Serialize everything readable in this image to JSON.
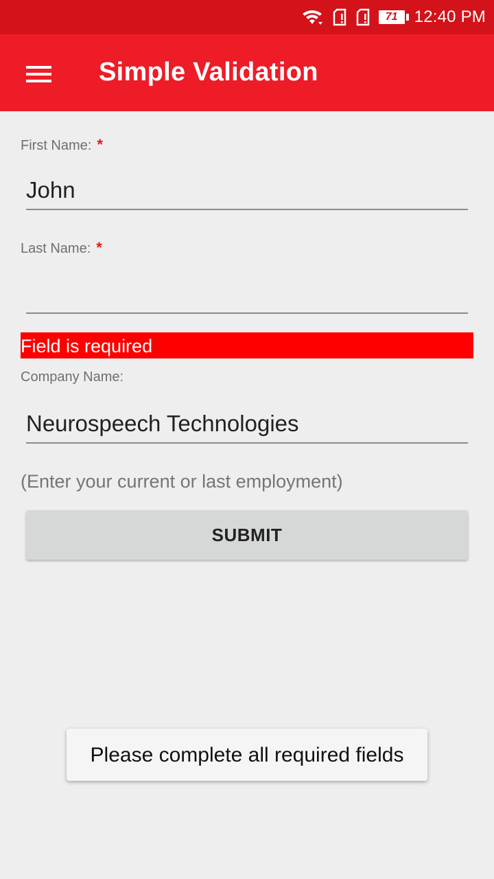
{
  "status_bar": {
    "battery_level": "71",
    "time": "12:40 PM",
    "icons": [
      "wifi-icon",
      "sim-card-alert-icon",
      "sim-card-alert-icon",
      "battery-icon"
    ],
    "background_color": "#d3121a"
  },
  "app_bar": {
    "menu_icon": "hamburger-menu-icon",
    "title": "Simple Validation",
    "background_color": "#ee1c27"
  },
  "form": {
    "first_name": {
      "label": "First Name:",
      "required_marker": "*",
      "value": "John"
    },
    "last_name": {
      "label": "Last Name:",
      "required_marker": "*",
      "value": "",
      "error": "Field is required"
    },
    "company_name": {
      "label": "Company Name:",
      "value": "Neurospeech Technologies",
      "hint": "(Enter your current or last employment)"
    },
    "submit_label": "SUBMIT"
  },
  "toast": {
    "message": "Please complete all required fields"
  },
  "colors": {
    "error_background": "#ff0000",
    "required_star": "#e51a1a",
    "page_background": "#eeeeee"
  }
}
